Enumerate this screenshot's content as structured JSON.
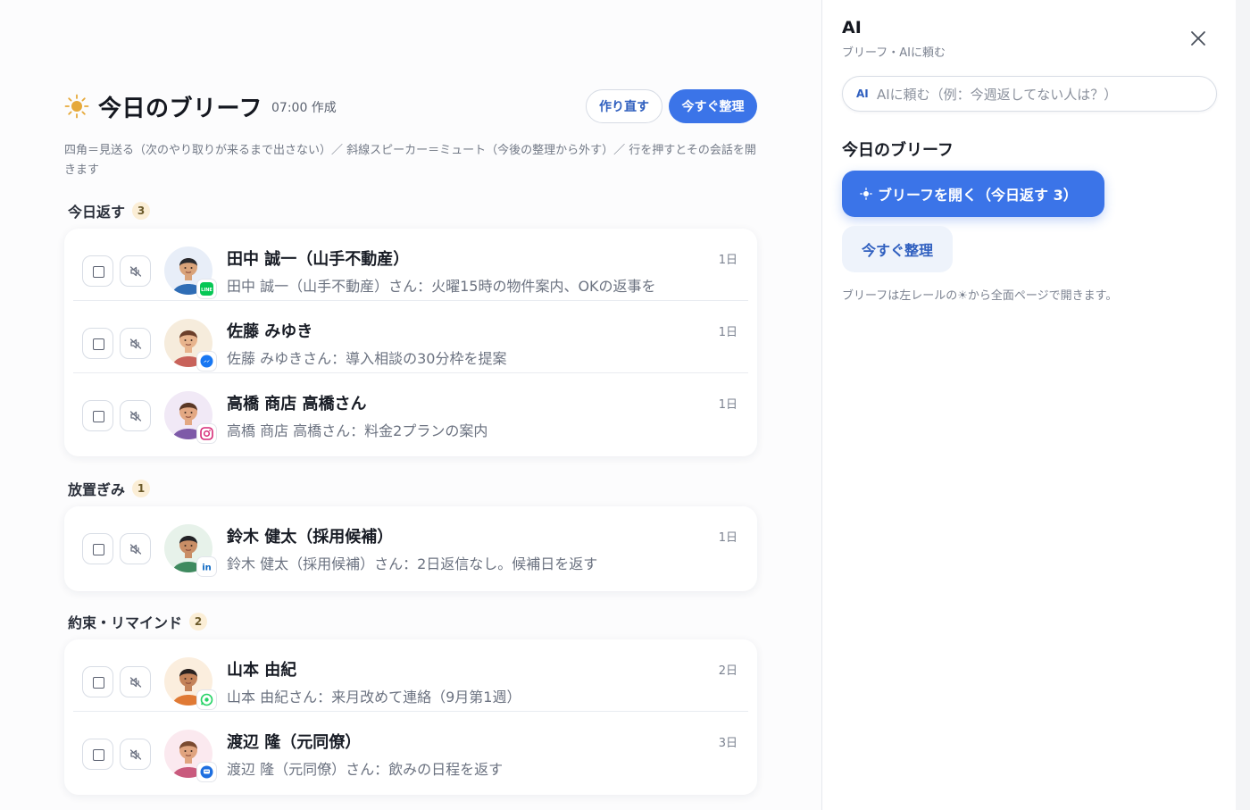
{
  "header": {
    "title": "今日のブリーフ",
    "created": "07:00 作成",
    "rebuild_label": "作り直す",
    "organize_label": "今すぐ整理"
  },
  "hint": "四角＝見送る（次のやり取りが来るまで出さない）／ 斜線スピーカー＝ミュート（今後の整理から外す）／ 行を押すとその会話を開きます",
  "sections": [
    {
      "title": "今日返す",
      "count": "3",
      "rows": [
        {
          "name": "田中 誠一（山手不動産）",
          "summary": "田中 誠一（山手不動産）さん：火曜15時の物件案内、OKの返事を",
          "time": "1日",
          "channel": "line-icon",
          "avatar_color": "#2f6db5",
          "skin": "#d9a37a",
          "hair": "#2a2a2e",
          "bg": "#e8eef8"
        },
        {
          "name": "佐藤 みゆき",
          "summary": "佐藤 みゆきさん：導入相談の30分枠を提案",
          "time": "1日",
          "channel": "messenger-icon",
          "avatar_color": "#c8625a",
          "skin": "#e8b48d",
          "hair": "#6b3f2a",
          "bg": "#f6ecdc"
        },
        {
          "name": "高橋 商店 高橋さん",
          "summary": "高橋 商店 高橋さん：料金2プランの案内",
          "time": "1日",
          "channel": "instagram-icon",
          "avatar_color": "#7e5aa8",
          "skin": "#e3a883",
          "hair": "#5a3826",
          "bg": "#f1e9f6"
        }
      ]
    },
    {
      "title": "放置ぎみ",
      "count": "1",
      "rows": [
        {
          "name": "鈴木 健太（採用候補）",
          "summary": "鈴木 健太（採用候補）さん：2日返信なし。候補日を返す",
          "time": "1日",
          "channel": "linkedin-icon",
          "avatar_color": "#3f8a5f",
          "skin": "#c98e66",
          "hair": "#222226",
          "bg": "#e7f2ea"
        }
      ]
    },
    {
      "title": "約束・リマインド",
      "count": "2",
      "rows": [
        {
          "name": "山本 由紀",
          "summary": "山本 由紀さん：来月改めて連絡（9月第1週）",
          "time": "2日",
          "channel": "whatsapp-icon",
          "avatar_color": "#e07a35",
          "skin": "#c4835a",
          "hair": "#2a2220",
          "bg": "#fbeede"
        },
        {
          "name": "渡辺 隆（元同僚）",
          "summary": "渡辺 隆（元同僚）さん：飲みの日程を返す",
          "time": "3日",
          "channel": "chat-icon",
          "avatar_color": "#c95a7d",
          "skin": "#e0a47f",
          "hair": "#7a4a30",
          "bg": "#fbe9ef"
        }
      ]
    }
  ],
  "panel": {
    "title": "AI",
    "subtitle": "ブリーフ・AIに頼む",
    "ai_tag": "AI",
    "input_placeholder": "AIに頼む（例：今週返してない人は？）",
    "section_title": "今日のブリーフ",
    "open_label": "ブリーフを開く（今日返す 3）",
    "organize_label": "今すぐ整理",
    "note": "ブリーフは左レールの☀から全面ページで開きます。"
  },
  "colors": {
    "accent": "#3b74e8",
    "accent_text": "#2f5fbf",
    "badge_bg": "#fbeed6"
  }
}
